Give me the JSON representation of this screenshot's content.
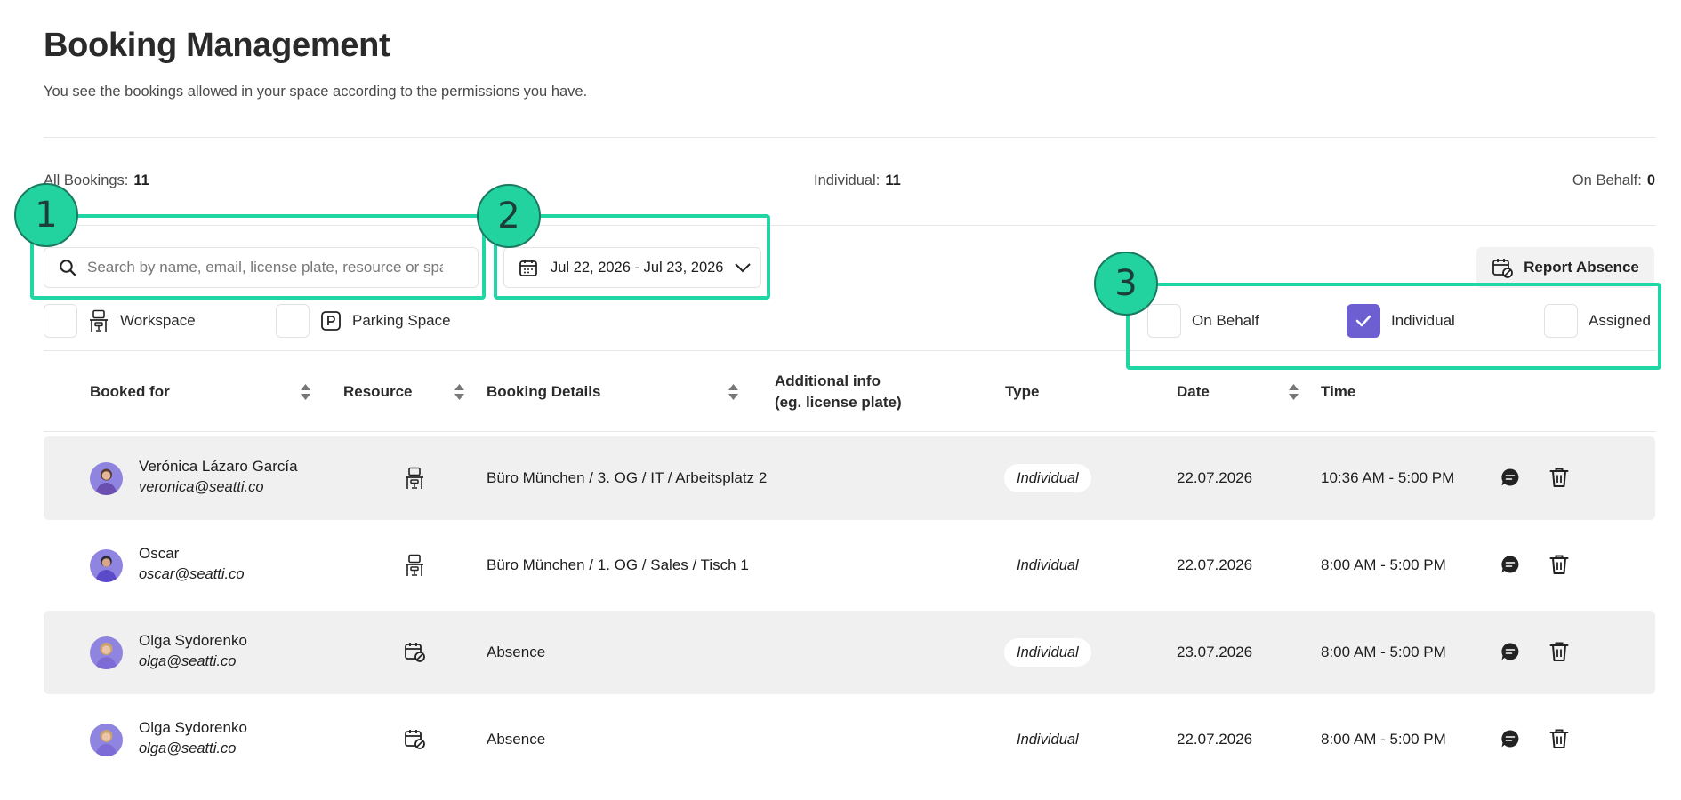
{
  "header": {
    "title": "Booking Management",
    "subtitle": "You see the bookings allowed in your space according to the permissions you have."
  },
  "stats": {
    "all_label": "All Bookings:",
    "all_value": "11",
    "individual_label": "Individual:",
    "individual_value": "11",
    "onbehalf_label": "On Behalf:",
    "onbehalf_value": "0"
  },
  "search": {
    "placeholder": "Search by name, email, license plate, resource or space",
    "value": ""
  },
  "date_range": {
    "value": "Jul 22, 2026 - Jul 23, 2026"
  },
  "actions": {
    "report_absence": "Report Absence"
  },
  "resource_filters": [
    {
      "label": "Workspace",
      "icon": "desk-chair-icon",
      "checked": false
    },
    {
      "label": "Parking Space",
      "icon": "parking-icon",
      "checked": false
    }
  ],
  "type_filters": [
    {
      "label": "On Behalf",
      "checked": false
    },
    {
      "label": "Individual",
      "checked": true
    },
    {
      "label": "Assigned",
      "checked": false
    }
  ],
  "table": {
    "columns": {
      "booked_for": "Booked for",
      "resource": "Resource",
      "details": "Booking Details",
      "additional_line1": "Additional info",
      "additional_line2": "(eg. license plate)",
      "type": "Type",
      "date": "Date",
      "time": "Time"
    },
    "rows": [
      {
        "name": "Verónica Lázaro García",
        "email": "veronica@seatti.co",
        "resource_icon": "desk-chair-icon",
        "details": "Büro München / 3. OG / IT / Arbeitsplatz 2",
        "type": "Individual",
        "date": "22.07.2026",
        "time": "10:36 AM - 5:00 PM"
      },
      {
        "name": "Oscar",
        "email": "oscar@seatti.co",
        "resource_icon": "desk-chair-icon",
        "details": "Büro München / 1. OG / Sales / Tisch 1",
        "type": "Individual",
        "date": "22.07.2026",
        "time": "8:00 AM - 5:00 PM"
      },
      {
        "name": "Olga Sydorenko",
        "email": "olga@seatti.co",
        "resource_icon": "calendar-absence-icon",
        "details": "Absence",
        "type": "Individual",
        "date": "23.07.2026",
        "time": "8:00 AM - 5:00 PM"
      },
      {
        "name": "Olga Sydorenko",
        "email": "olga@seatti.co",
        "resource_icon": "calendar-absence-icon",
        "details": "Absence",
        "type": "Individual",
        "date": "22.07.2026",
        "time": "8:00 AM - 5:00 PM"
      }
    ]
  },
  "annotations": [
    "1",
    "2",
    "3"
  ],
  "colors": {
    "accent": "#6d5fd2",
    "highlight": "#20d6a4",
    "row_shade": "#f0f0f0"
  }
}
